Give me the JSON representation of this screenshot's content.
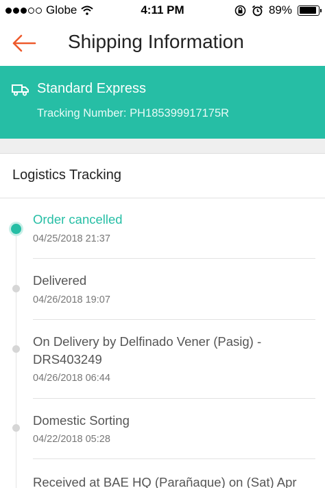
{
  "status_bar": {
    "carrier": "Globe",
    "time": "4:11 PM",
    "battery_percent": "89%",
    "battery_level": 0.89
  },
  "header": {
    "title": "Shipping Information",
    "back_icon": "arrow-left-icon"
  },
  "shipping": {
    "service": "Standard Express",
    "tracking": "Tracking Number: PH185399917175R",
    "icon": "truck-icon"
  },
  "logistics": {
    "title": "Logistics Tracking",
    "events": [
      {
        "title": "Order cancelled",
        "time": "04/25/2018 21:37",
        "active": true
      },
      {
        "title": "Delivered",
        "time": "04/26/2018 19:07",
        "active": false
      },
      {
        "title_line1": "On Delivery by Delfinado Vener (Pasig) -",
        "title_line2": "DRS403249",
        "time": "04/26/2018 06:44",
        "active": false
      },
      {
        "title": "Domestic Sorting",
        "time": "04/22/2018 05:28",
        "active": false
      },
      {
        "title": "Received at BAE HQ (Parañaque) on (Sat) Apr",
        "active": false
      }
    ]
  },
  "colors": {
    "accent": "#26bea5",
    "back_arrow": "#ee5a2c"
  }
}
